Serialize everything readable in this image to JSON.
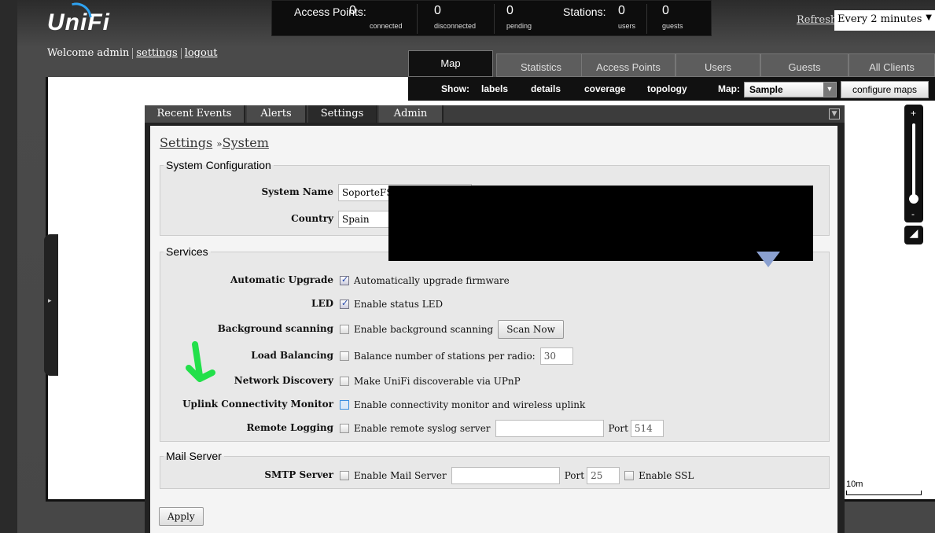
{
  "brand": {
    "logo": "UniFi"
  },
  "stats": {
    "access_points_title": "Access Points:",
    "ap_connected": {
      "value": "0",
      "label": "connected"
    },
    "ap_disconnected": {
      "value": "0",
      "label": "disconnected"
    },
    "ap_pending": {
      "value": "0",
      "label": "pending"
    },
    "stations_title": "Stations:",
    "st_users": {
      "value": "0",
      "label": "users"
    },
    "st_guests": {
      "value": "0",
      "label": "guests"
    }
  },
  "refresh": {
    "link": "Refresh",
    "selected": "Every 2 minutes"
  },
  "user": {
    "welcome": "Welcome admin",
    "settings": "settings",
    "logout": "logout"
  },
  "nav_tabs": [
    {
      "label": "Map",
      "active": true
    },
    {
      "label": "Statistics"
    },
    {
      "label": "Access Points"
    },
    {
      "label": "Users"
    },
    {
      "label": "Guests"
    },
    {
      "label": "All Clients"
    }
  ],
  "showbar": {
    "show_label": "Show:",
    "labels": "labels",
    "details": "details",
    "coverage": "coverage",
    "topology": "topology",
    "map_label": "Map:",
    "map_selected": "Sample",
    "configure_maps": "configure maps"
  },
  "map": {
    "scale_label": "10m",
    "zoom_plus": "+",
    "zoom_minus": "-"
  },
  "panel": {
    "tabs": [
      {
        "label": "Recent Events"
      },
      {
        "label": "Alerts"
      },
      {
        "label": "Settings",
        "active": true
      },
      {
        "label": "Admin"
      }
    ],
    "breadcrumb": {
      "root": "Settings",
      "sep": "»",
      "current": "System"
    },
    "system_config": {
      "legend": "System Configuration",
      "system_name_label": "System Name",
      "system_name_value": "SoporteFS",
      "country_label": "Country",
      "country_value": "Spain"
    },
    "services": {
      "legend": "Services",
      "automatic_upgrade": {
        "label": "Automatic Upgrade",
        "text": "Automatically upgrade firmware",
        "checked": true
      },
      "led": {
        "label": "LED",
        "text": "Enable status LED",
        "checked": true
      },
      "background_scanning": {
        "label": "Background scanning",
        "text": "Enable background scanning",
        "button": "Scan Now",
        "checked": false
      },
      "load_balancing": {
        "label": "Load Balancing",
        "text": "Balance number of stations per radio:",
        "value": "30",
        "checked": false
      },
      "network_discovery": {
        "label": "Network Discovery",
        "text": "Make UniFi discoverable via UPnP",
        "checked": false
      },
      "uplink_monitor": {
        "label": "Uplink Connectivity Monitor",
        "text": "Enable connectivity monitor and wireless uplink",
        "checked": false
      },
      "remote_logging": {
        "label": "Remote Logging",
        "text": "Enable remote syslog server",
        "server_value": "",
        "port_label": "Port",
        "port_placeholder": "514",
        "checked": false
      }
    },
    "mail_server": {
      "legend": "Mail Server",
      "smtp_label": "SMTP Server",
      "enable_text": "Enable Mail Server",
      "server_value": "",
      "port_label": "Port",
      "port_placeholder": "25",
      "ssl_text": "Enable SSL"
    },
    "apply": "Apply"
  },
  "colors": {
    "accent_blue": "#2ea3f2",
    "annotation_green": "#22e04a"
  }
}
